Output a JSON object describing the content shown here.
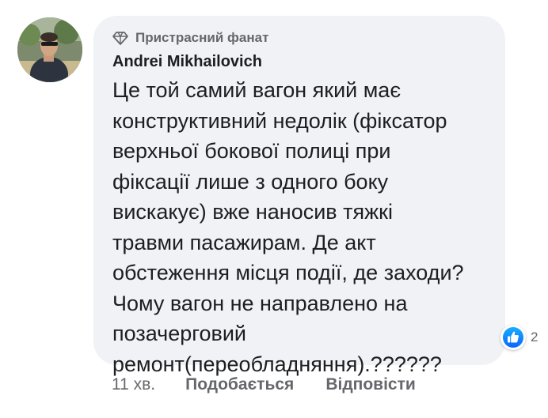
{
  "comment": {
    "badge_label": "Пристрасний фанат",
    "badge_icon": "diamond-icon",
    "author": "Andrei Mikhailovich",
    "text": "Це той самий вагон який має\nконструктивний недолік (фіксатор\nверхньої бокової полиці при\nфіксації лише з одного боку\nвискакує) вже наносив тяжкі\nтравми пасажирам. Де акт\nобстеження місця події, де заходи?\nЧому вагон не направлено на\nпозачерговий\nремонт(переобладняння).??????",
    "reaction_icon": "like-icon",
    "reaction_count": "2",
    "timestamp": "11 хв.",
    "like_label": "Подобається",
    "reply_label": "Відповісти",
    "colors": {
      "bubble": "#f0f2f5",
      "secondary_text": "#65676b",
      "primary_text": "#1c1e21",
      "like_blue": "#1877f2"
    }
  }
}
